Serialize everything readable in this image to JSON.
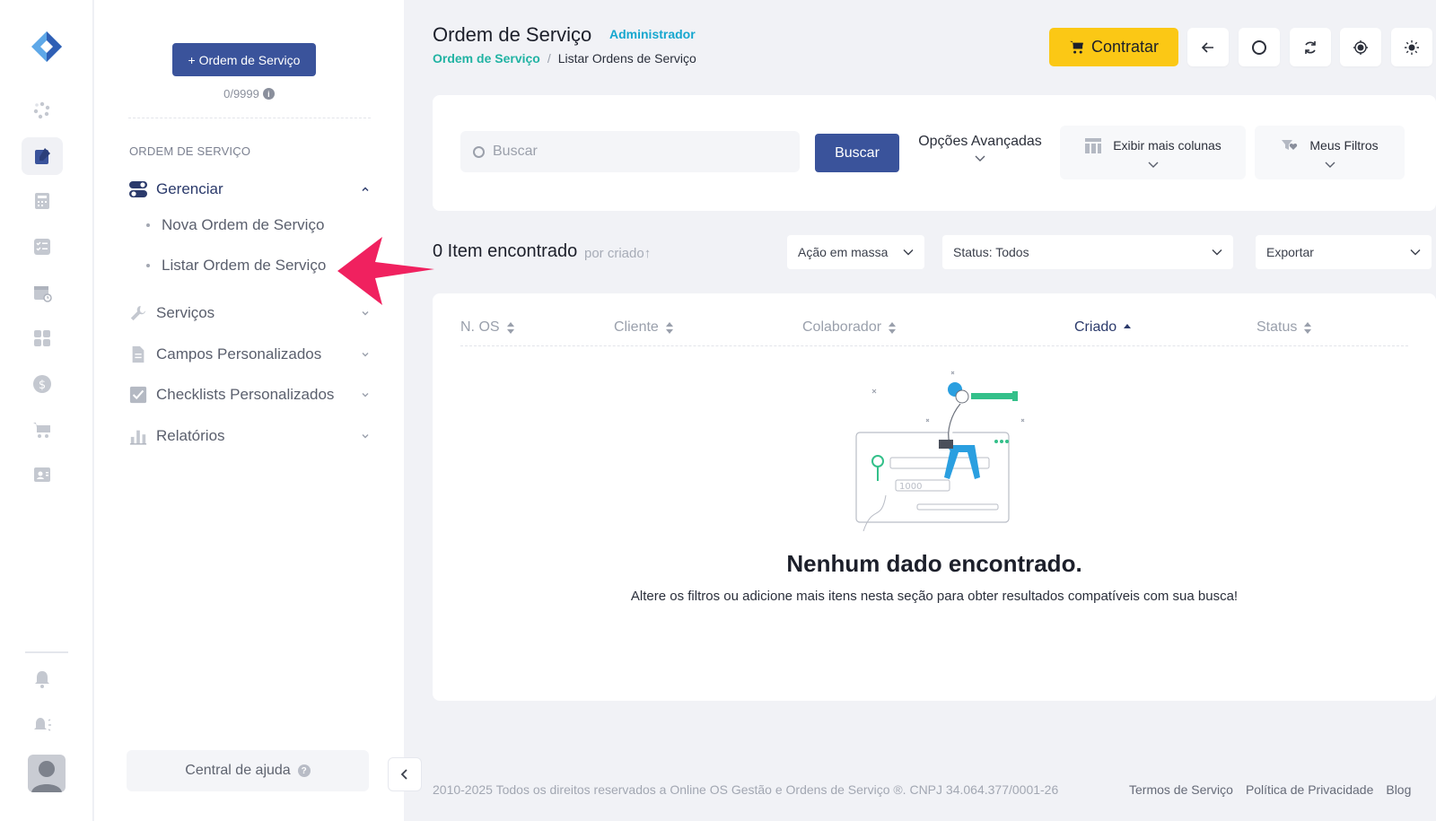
{
  "sidebar": {
    "new_button": "+ Ordem de Serviço",
    "quota": "0/9999",
    "section_title": "ORDEM DE SERVIÇO",
    "menu": [
      {
        "label": "Gerenciar",
        "icon": "toggle-icon",
        "open": true
      },
      {
        "label": "Serviços",
        "icon": "wrench-icon"
      },
      {
        "label": "Campos Personalizados",
        "icon": "document-icon"
      },
      {
        "label": "Checklists Personalizados",
        "icon": "checkbox-icon"
      },
      {
        "label": "Relatórios",
        "icon": "bar-chart-icon"
      }
    ],
    "submenu": [
      {
        "label": "Nova Ordem de Serviço"
      },
      {
        "label": "Listar Ordem de Serviço"
      }
    ],
    "help": "Central de ajuda"
  },
  "header": {
    "title": "Ordem de Serviço",
    "role": "Administrador",
    "breadcrumb": {
      "link": "Ordem de Serviço",
      "separator": "/",
      "current": "Listar Ordens de Serviço"
    },
    "contratar": "Contratar"
  },
  "search": {
    "placeholder": "Buscar",
    "button": "Buscar",
    "advanced": "Opções Avançadas",
    "more_columns": "Exibir mais colunas",
    "my_filters": "Meus Filtros"
  },
  "results": {
    "count": "0 Item encontrado",
    "sort_hint": "por criado↑",
    "bulk_action": "Ação em massa",
    "status_filter": "Status: Todos",
    "export": "Exportar"
  },
  "table": {
    "columns": [
      "N. OS",
      "Cliente",
      "Colaborador",
      "Criado",
      "Status"
    ],
    "active_column": "Criado",
    "empty_title": "Nenhum dado encontrado.",
    "empty_message": "Altere os filtros ou adicione mais itens nesta seção para obter resultados compatíveis com sua busca!"
  },
  "footer": {
    "copyright": "2010-2025 Todos os direitos reservados a Online OS Gestão e Ordens de Serviço ®. CNPJ 34.064.377/0001-26",
    "links": [
      "Termos de Serviço",
      "Política de Privacidade",
      "Blog"
    ]
  },
  "colors": {
    "primary": "#3a539b",
    "accent_yellow": "#fbc815",
    "teal_link": "#21b3a3",
    "role_blue": "#16a7cf",
    "annotation_pink": "#f0215f"
  }
}
